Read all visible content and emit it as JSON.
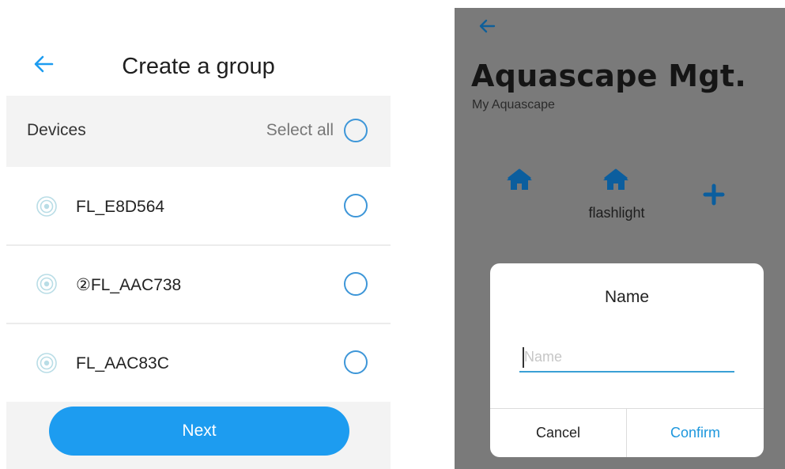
{
  "create_group": {
    "title": "Create a group",
    "devices_label": "Devices",
    "select_all_label": "Select all",
    "devices": [
      {
        "name": "FL_E8D564",
        "selected": false
      },
      {
        "name": "②FL_AAC738",
        "selected": false
      },
      {
        "name": "FL_AAC83C",
        "selected": false
      }
    ],
    "next_label": "Next"
  },
  "aquascape": {
    "title": "Aquascape Mgt.",
    "subtitle": "My Aquascape",
    "home_items": [
      {
        "icon": "home-icon",
        "label": ""
      },
      {
        "icon": "home-icon",
        "label": "flashlight"
      }
    ],
    "add_icon": "plus-icon",
    "dialog": {
      "title": "Name",
      "input_value": "",
      "input_placeholder": "Name",
      "cancel_label": "Cancel",
      "confirm_label": "Confirm"
    }
  },
  "colors": {
    "accent": "#1d9cf0",
    "icon_blue": "#0b5e9e",
    "overlay": "#7a7a7a"
  }
}
